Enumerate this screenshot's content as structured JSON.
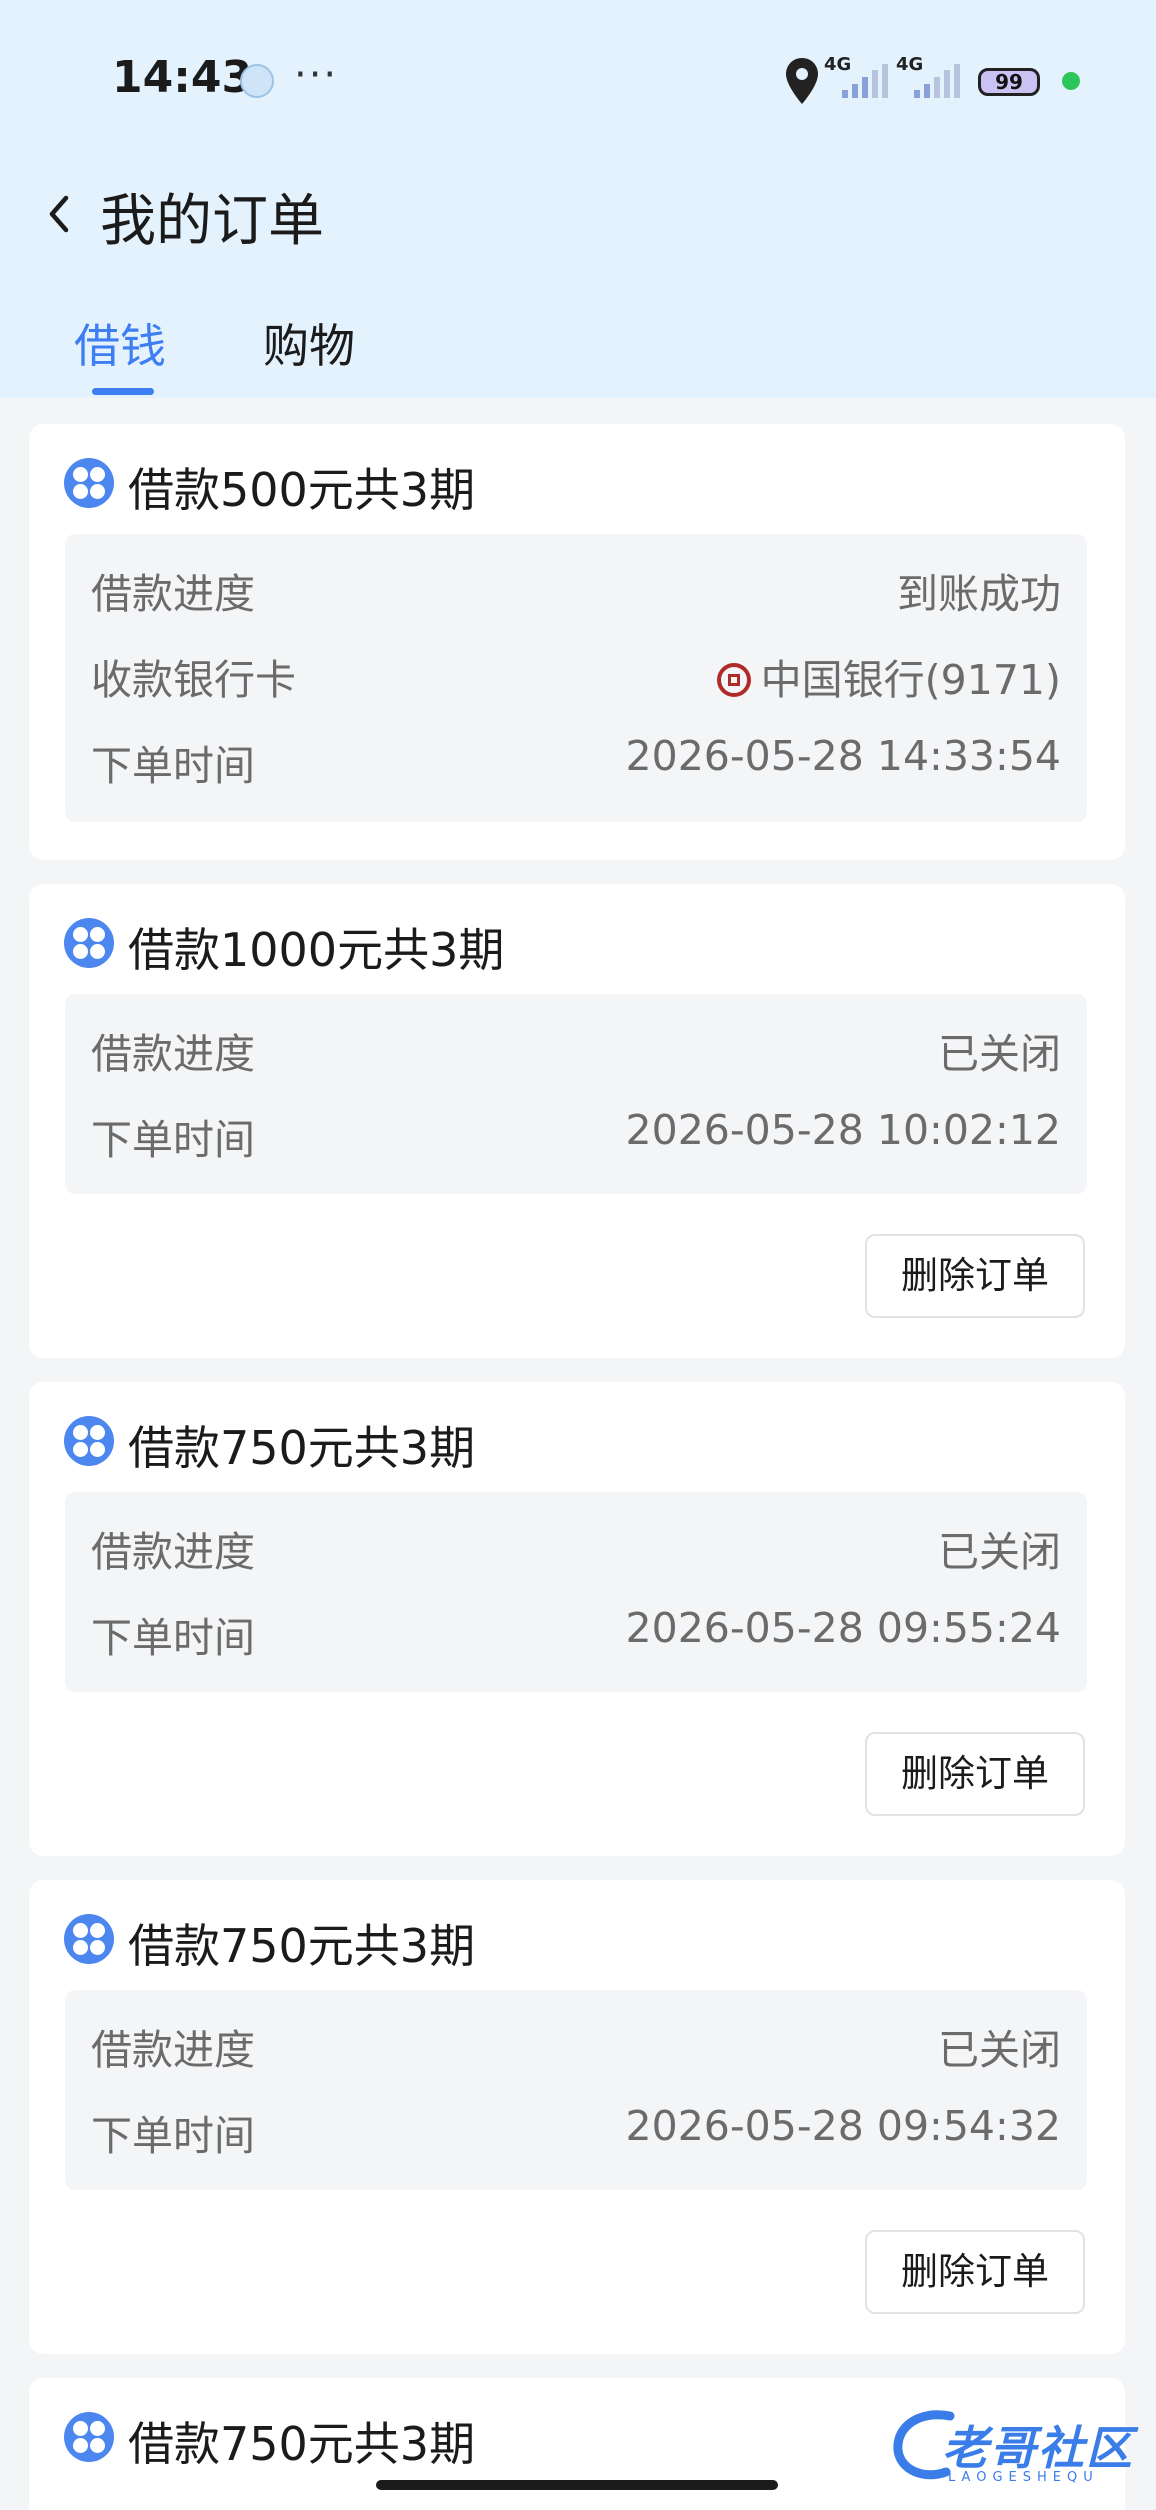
{
  "status_bar": {
    "time": "14:43",
    "more": "···",
    "network_1": "4G",
    "network_2": "4G",
    "battery": "99",
    "icons": [
      "app-notification-icon",
      "location-icon",
      "signal-icon",
      "signal-icon",
      "battery-icon",
      "green-dot-indicator"
    ]
  },
  "header": {
    "title": "我的订单",
    "back_icon": "chevron-left-icon"
  },
  "tabs": [
    {
      "label": "借钱",
      "active": true
    },
    {
      "label": "购物",
      "active": false
    }
  ],
  "accent_color": "#3d7ef2",
  "orders": [
    {
      "title": "借款500元共3期",
      "rows": [
        {
          "label": "借款进度",
          "value": "到账成功"
        },
        {
          "label": "收款银行卡",
          "value": "中国银行(9171)",
          "icon": "bank-of-china-icon"
        },
        {
          "label": "下单时间",
          "value": "2026-05-28 14:33:54"
        }
      ]
    },
    {
      "title": "借款1000元共3期",
      "rows": [
        {
          "label": "借款进度",
          "value": "已关闭"
        },
        {
          "label": "下单时间",
          "value": "2026-05-28 10:02:12"
        }
      ],
      "action": "删除订单"
    },
    {
      "title": "借款750元共3期",
      "rows": [
        {
          "label": "借款进度",
          "value": "已关闭"
        },
        {
          "label": "下单时间",
          "value": "2026-05-28 09:55:24"
        }
      ],
      "action": "删除订单"
    },
    {
      "title": "借款750元共3期",
      "rows": [
        {
          "label": "借款进度",
          "value": "已关闭"
        },
        {
          "label": "下单时间",
          "value": "2026-05-28 09:54:32"
        }
      ],
      "action": "删除订单"
    },
    {
      "title": "借款750元共3期"
    }
  ],
  "watermark": {
    "text": "老哥社区",
    "sub": "LAOGESHEQU"
  }
}
